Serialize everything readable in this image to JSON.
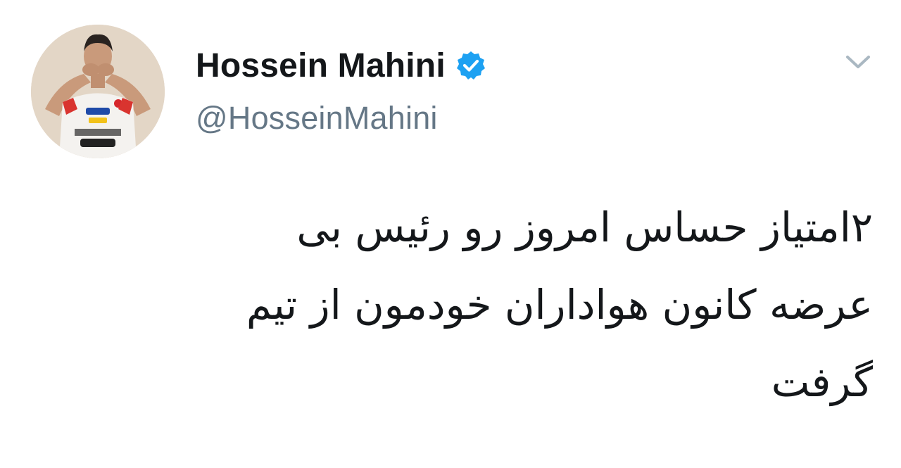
{
  "user": {
    "display_name": "Hossein Mahini",
    "handle": "@HosseinMahini",
    "verified": true,
    "verified_color": "#1DA1F2",
    "avatar_icon": "user-avatar-photo"
  },
  "tweet": {
    "lines": [
      "۲امتیاز حساس امروز رو رئیس بی",
      "عرضه کانون هواداران خودمون از تیم",
      "گرفت"
    ]
  },
  "menu": {
    "icon": "chevron-down-icon"
  },
  "colors": {
    "text_primary": "#14171a",
    "text_secondary": "#657786",
    "chevron": "#aab8c2"
  }
}
